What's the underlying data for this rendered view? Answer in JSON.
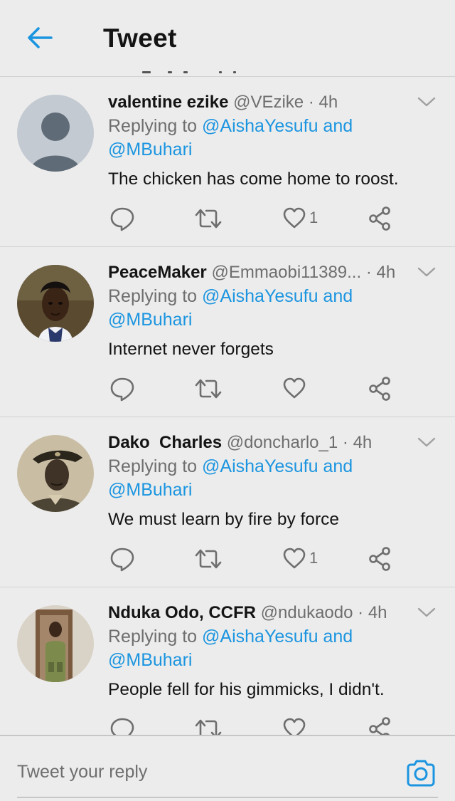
{
  "header": {
    "title": "Tweet"
  },
  "tweets": [
    {
      "name": "valentine ezike",
      "handle": "@VEzike",
      "time": "4h",
      "reply_prefix": "Replying to",
      "reply_targets": "@AishaYesufu and",
      "reply_targets_2": "@MBuhari",
      "text": "The chicken has come home to roost.",
      "likes": "1"
    },
    {
      "name": "PeaceMaker",
      "handle": "@Emmaobi11389...",
      "time": "4h",
      "reply_prefix": "Replying to",
      "reply_targets": "@AishaYesufu and",
      "reply_targets_2": "@MBuhari",
      "text": "Internet never forgets",
      "likes": ""
    },
    {
      "name": "Dako  Charles",
      "handle": "@doncharlo_1",
      "time": "4h",
      "reply_prefix": "Replying to",
      "reply_targets": "@AishaYesufu and",
      "reply_targets_2": "@MBuhari",
      "text": "We must learn by fire by force",
      "likes": "1"
    },
    {
      "name": "Nduka Odo, CCFR",
      "handle": "@ndukaodo",
      "time": "4h",
      "reply_prefix": "Replying to",
      "reply_targets": "@AishaYesufu and",
      "reply_targets_2": "@MBuhari",
      "text": "People fell for his gimmicks, I didn't.",
      "likes": ""
    }
  ],
  "composer": {
    "placeholder": "Tweet your reply"
  },
  "icons": {
    "back": "arrow-left-icon",
    "more": "chevron-down-icon",
    "reply": "speech-bubble-icon",
    "retweet": "retweet-icon",
    "like": "heart-icon",
    "share": "share-icon",
    "camera": "camera-icon"
  },
  "colors": {
    "accent": "#1b95e0",
    "background": "#ececec",
    "muted": "#6e6e6e"
  }
}
